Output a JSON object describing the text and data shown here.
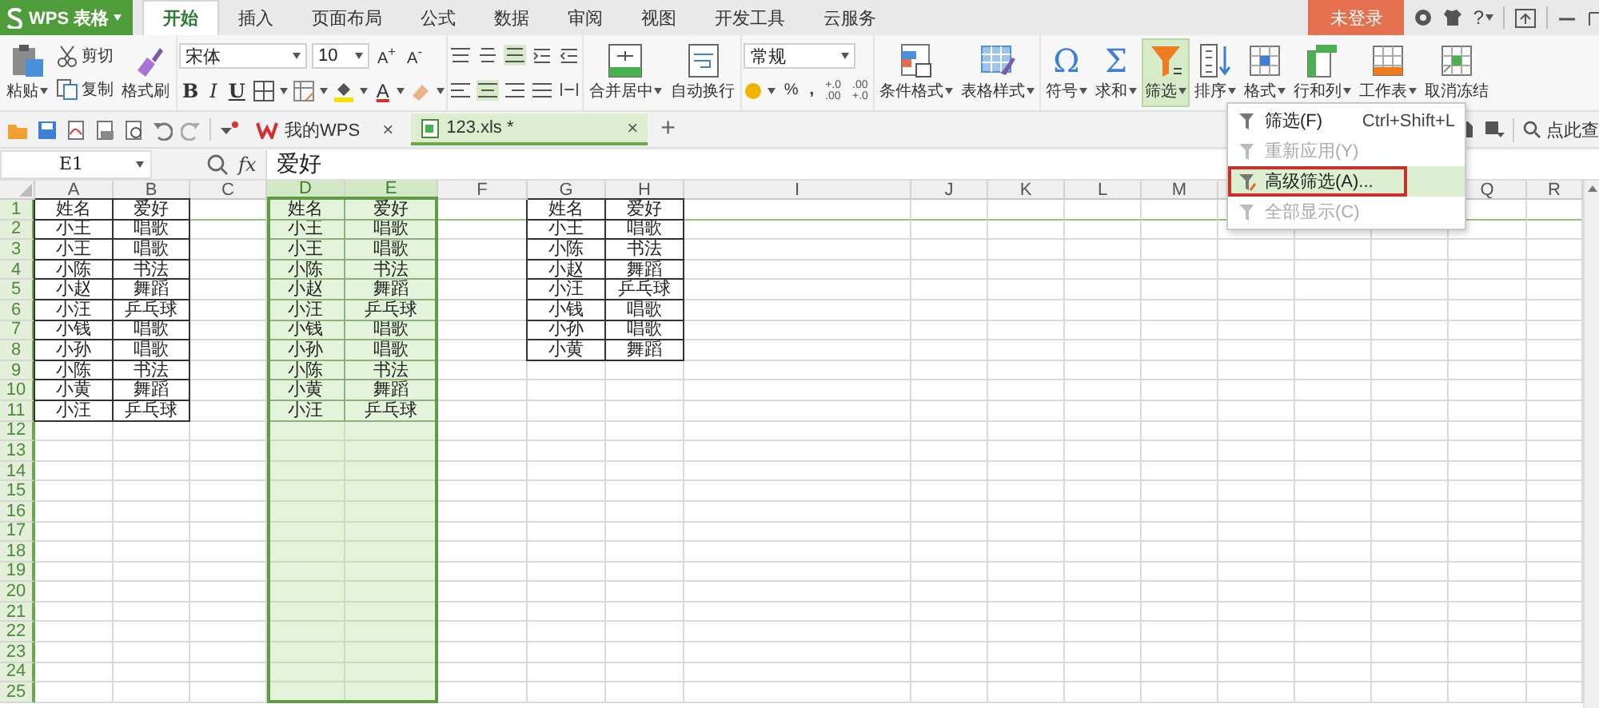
{
  "title_bar": {
    "app_name": "WPS 表格",
    "menu_tabs": [
      {
        "label": "开始",
        "selected": true
      },
      {
        "label": "插入",
        "selected": false
      },
      {
        "label": "页面布局",
        "selected": false
      },
      {
        "label": "公式",
        "selected": false
      },
      {
        "label": "数据",
        "selected": false
      },
      {
        "label": "审阅",
        "selected": false
      },
      {
        "label": "视图",
        "selected": false
      },
      {
        "label": "开发工具",
        "selected": false
      },
      {
        "label": "云服务",
        "selected": false
      }
    ],
    "login": "未登录",
    "help": "?"
  },
  "ribbon": {
    "paste": "粘贴",
    "cut": "剪切",
    "copy": "复制",
    "format_painter": "格式刷",
    "font_name": "宋体",
    "font_size": "10",
    "grow_font": "A$^{+}$",
    "shrink_font": "A$^{-}$",
    "bold": "B",
    "italic": "I",
    "underline": "U",
    "font_color": "A",
    "vertical_align": [
      {
        "selected": false
      },
      {
        "selected": false
      },
      {
        "selected": true
      }
    ],
    "horizontal_align": [
      {
        "selected": false
      },
      {
        "selected": true
      },
      {
        "selected": false
      },
      {
        "selected": false
      }
    ],
    "merge_center": "合并居中",
    "wrap_text": "自动换行",
    "number_format": "常规",
    "percent": "%",
    "comma": ",",
    "increase_decimal": [
      "+.0",
      ".00"
    ],
    "decrease_decimal": [
      ".00",
      "+.0"
    ],
    "conditional_format": "条件格式",
    "table_style": "表格样式",
    "tools": [
      {
        "label": "符号",
        "glyph": "Ω",
        "selected": false,
        "dropdown": true
      },
      {
        "label": "求和",
        "glyph": "Σ",
        "selected": false,
        "dropdown": true
      },
      {
        "label": "筛选",
        "selected": true,
        "dropdown": true
      },
      {
        "label": "排序",
        "selected": false,
        "dropdown": true
      },
      {
        "label": "格式",
        "selected": false,
        "dropdown": true
      },
      {
        "label": "行和列",
        "selected": false,
        "dropdown": true
      },
      {
        "label": "工作表",
        "selected": false,
        "dropdown": true
      },
      {
        "label": "取消冻结",
        "selected": false,
        "dropdown": false
      }
    ]
  },
  "doc_tabs": {
    "tabs": [
      {
        "label": "我的WPS",
        "selected": false,
        "close": "×"
      },
      {
        "label": "123.xls *",
        "selected": true,
        "close": "×"
      }
    ],
    "new_tab": "+",
    "search_placeholder": "点此查"
  },
  "formula_bar": {
    "cell_ref": "E1",
    "fx": "fx",
    "value": "爱好"
  },
  "sheet": {
    "columns": [
      {
        "label": "A",
        "selected": false
      },
      {
        "label": "B",
        "selected": false
      },
      {
        "label": "C",
        "selected": false
      },
      {
        "label": "D",
        "selected": true
      },
      {
        "label": "E",
        "selected": true
      },
      {
        "label": "F",
        "selected": false
      },
      {
        "label": "G",
        "selected": false
      },
      {
        "label": "H",
        "selected": false
      },
      {
        "label": "I",
        "selected": false
      },
      {
        "label": "J",
        "selected": false
      },
      {
        "label": "K",
        "selected": false
      },
      {
        "label": "L",
        "selected": false
      },
      {
        "label": "M",
        "selected": false
      },
      {
        "selected": false
      },
      {
        "selected": false
      },
      {
        "selected": false
      },
      {
        "label": "Q",
        "selected": false
      },
      {
        "label": "R",
        "selected": false
      }
    ],
    "rows": [
      "1",
      "2",
      "3",
      "4",
      "5",
      "6",
      "7",
      "8",
      "9",
      "10",
      "11",
      "12",
      "13",
      "14",
      "15",
      "16",
      "17",
      "18",
      "19",
      "20",
      "21",
      "22",
      "23",
      "24",
      "25"
    ],
    "cells": [
      [
        "姓名",
        "爱好",
        null,
        "姓名",
        "爱好",
        null,
        "姓名",
        "爱好"
      ],
      [
        "小王",
        "唱歌",
        null,
        "小王",
        "唱歌",
        null,
        "小王",
        "唱歌"
      ],
      [
        "小王",
        "唱歌",
        null,
        "小王",
        "唱歌",
        null,
        "小陈",
        "书法"
      ],
      [
        "小陈",
        "书法",
        null,
        "小陈",
        "书法",
        null,
        "小赵",
        "舞蹈"
      ],
      [
        "小赵",
        "舞蹈",
        null,
        "小赵",
        "舞蹈",
        null,
        "小汪",
        "乒乓球"
      ],
      [
        "小汪",
        "乒乓球",
        null,
        "小汪",
        "乒乓球",
        null,
        "小钱",
        "唱歌"
      ],
      [
        "小钱",
        "唱歌",
        null,
        "小钱",
        "唱歌",
        null,
        "小孙",
        "唱歌"
      ],
      [
        "小孙",
        "唱歌",
        null,
        "小孙",
        "唱歌",
        null,
        "小黄",
        "舞蹈"
      ],
      [
        "小陈",
        "书法",
        null,
        "小陈",
        "书法"
      ],
      [
        "小黄",
        "舞蹈",
        null,
        "小黄",
        "舞蹈"
      ],
      [
        "小汪",
        "乒乓球",
        null,
        "小汪",
        "乒乓球"
      ]
    ]
  },
  "filter_menu": {
    "items": [
      {
        "label": "筛选(F)",
        "shortcut": "Ctrl+Shift+L",
        "disabled": false,
        "selected": false,
        "outlined": false
      },
      {
        "label": "重新应用(Y)",
        "disabled": true,
        "selected": false,
        "outlined": false
      },
      {
        "label": "高级筛选(A)...",
        "disabled": false,
        "selected": true,
        "outlined": true
      },
      {
        "label": "全部显示(C)",
        "disabled": true,
        "selected": false,
        "outlined": false
      }
    ]
  }
}
